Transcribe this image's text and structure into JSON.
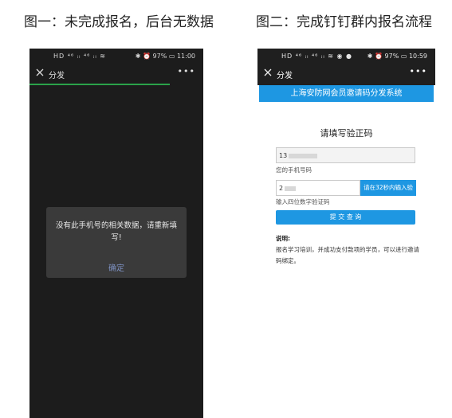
{
  "captions": {
    "left": "图一：未完成报名，后台无数据",
    "right": "图二：完成钉钉群内报名流程"
  },
  "phone1": {
    "status": {
      "left": "HD ⁴⁶ ᵢₗ ⁴⁶ ᵢₗ ≋",
      "right": "✱ ⏰ 97% ▭ 11:00"
    },
    "nav": {
      "title": "分发",
      "more": "•••"
    },
    "dialog": {
      "message": "没有此手机号的相关数据，请重新填写!",
      "confirm": "确定"
    }
  },
  "phone2": {
    "status": {
      "left": "HD ⁴⁶ ᵢₗ ⁴⁶ ᵢₗ ≋ ◉ ●",
      "right": "✱ ⏰ 97% ▭ 10:59"
    },
    "nav": {
      "title": "分发",
      "more": "•••"
    },
    "banner": "上海安防网会员邀请码分发系统",
    "form": {
      "title": "请填写验正码",
      "phone_value": "13",
      "phone_hint": "您的手机号码",
      "code_value": "2",
      "code_button": "请在32秒内输入验",
      "code_hint": "输入四位数字验证码",
      "submit": "提 交 查 询"
    },
    "note": {
      "title": "说明:",
      "text": "报名学习培训，并成功支付款项的学员，可以进行邀请码绑定。"
    }
  },
  "colors": {
    "accent": "#1e97e2",
    "progress": "#2aa24a",
    "dark": "#1c1c1c"
  }
}
